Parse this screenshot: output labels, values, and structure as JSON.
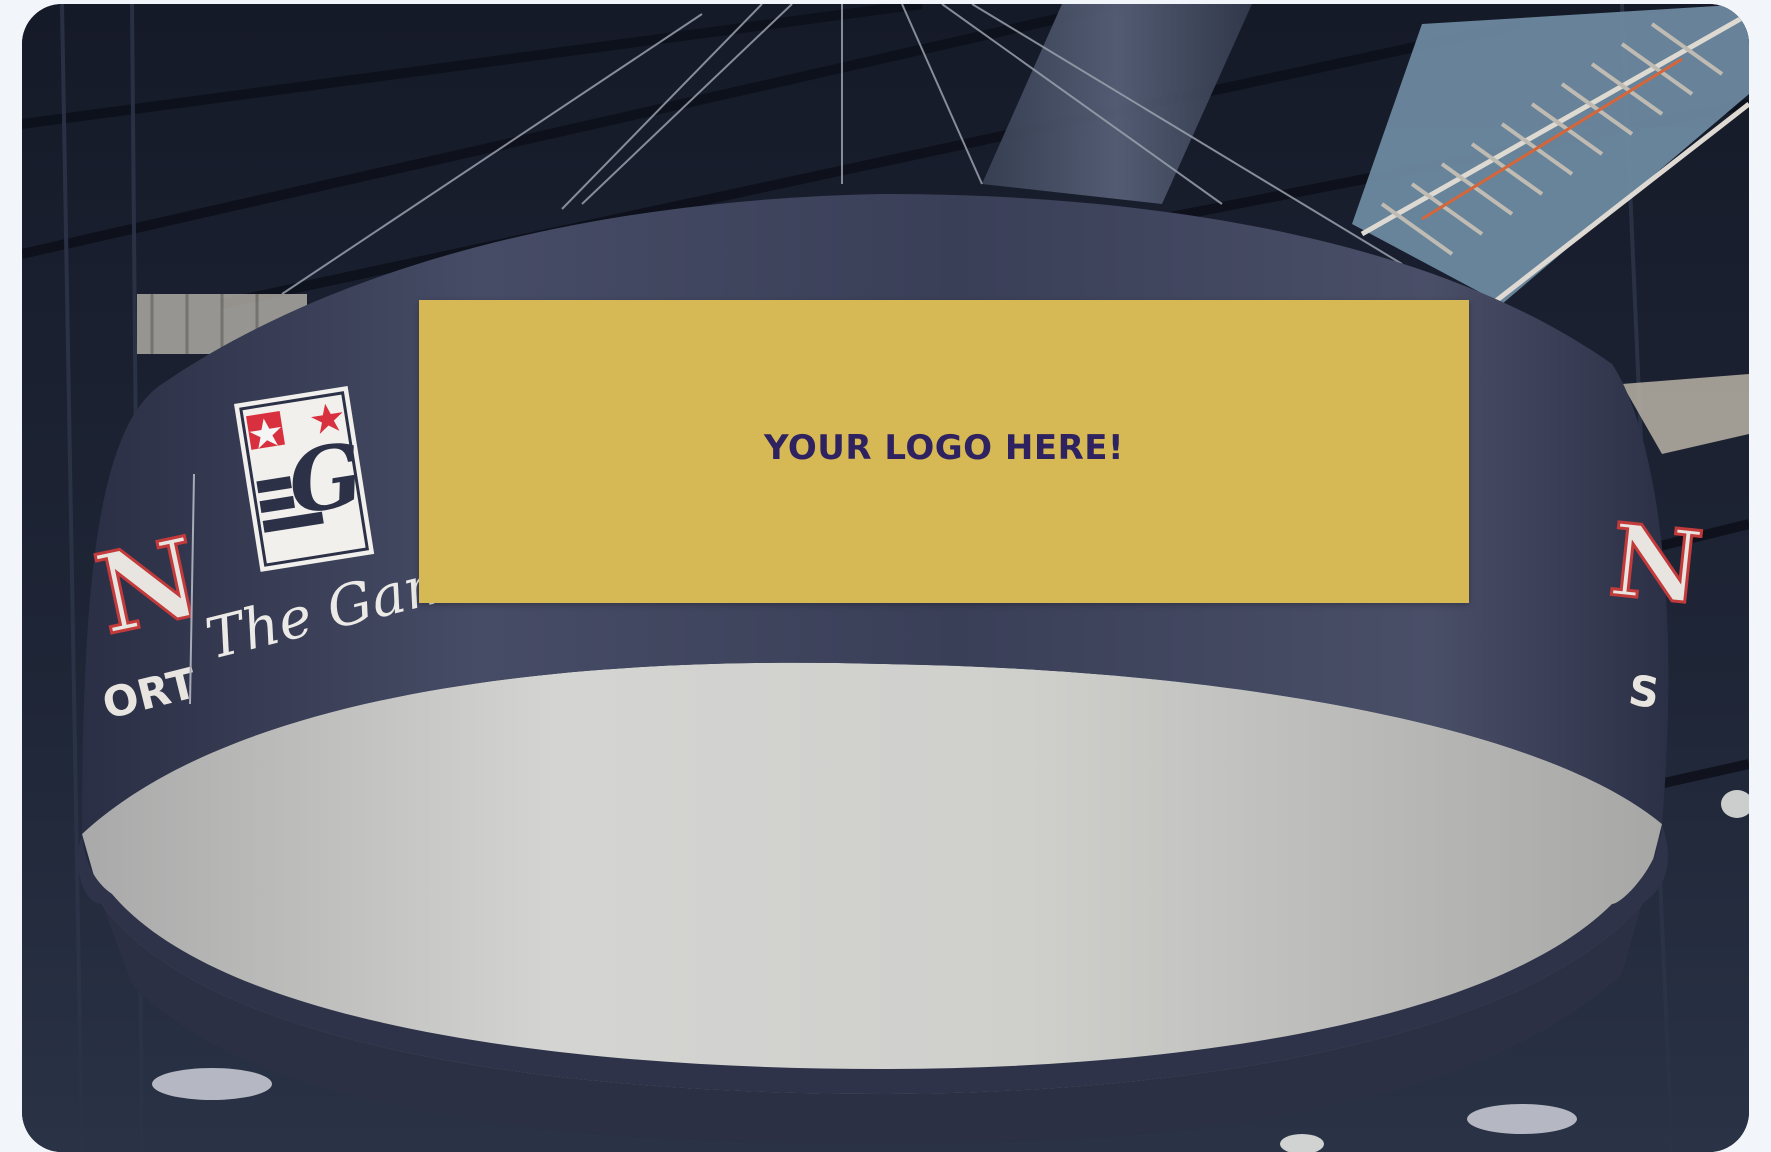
{
  "banner": {
    "placeholder_text": "YOUR LOGO HERE!",
    "placeholder_color": "#d6b954",
    "placeholder_text_color": "#2e2360",
    "fabric_color": "#343a55",
    "inner_color": "#d2d2d0"
  },
  "brand": {
    "left_wordmark": "The Game",
    "left_letter_fragment": "N",
    "left_text_fragment": "ORT",
    "right_letter_fragment": "N",
    "right_text_fragment": "S"
  }
}
